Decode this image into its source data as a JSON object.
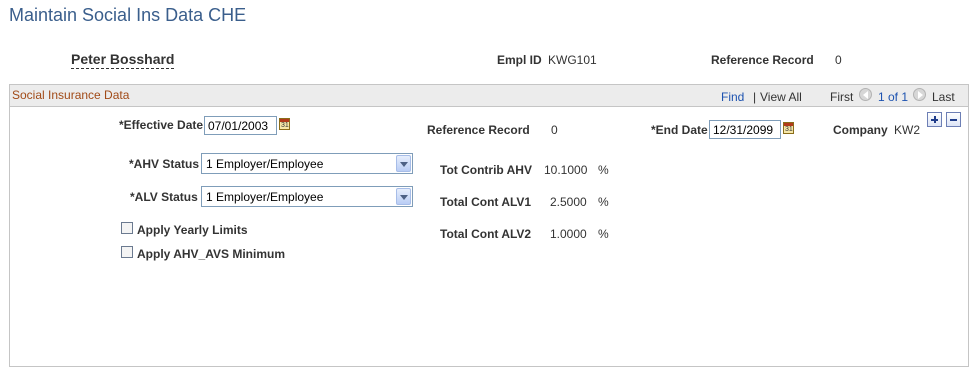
{
  "page": {
    "title": "Maintain Social Ins Data CHE"
  },
  "employee": {
    "name": "Peter Bosshard",
    "empl_id_label": "Empl ID",
    "empl_id": "KWG101",
    "ref_record_label": "Reference Record",
    "ref_record": "0"
  },
  "panel": {
    "title": "Social Insurance Data",
    "find": "Find",
    "separator": "|",
    "view_all": "View All",
    "first": "First",
    "page_info": "1 of 1",
    "last": "Last"
  },
  "form": {
    "effective_date_label": "*Effective Date",
    "effective_date": "07/01/2003",
    "reference_record_label": "Reference Record",
    "reference_record": "0",
    "end_date_label": "*End Date",
    "end_date": "12/31/2099",
    "company_label": "Company",
    "company": "KW2",
    "ahv_status_label": "*AHV Status",
    "ahv_status": "1 Employer/Employee",
    "alv_status_label": "*ALV Status",
    "alv_status": "1 Employer/Employee",
    "apply_yearly_limits_label": "Apply Yearly Limits",
    "apply_yearly_limits": false,
    "apply_ahv_min_label": "Apply AHV_AVS Minimum",
    "apply_ahv_min": false,
    "tot_contrib_ahv_label": "Tot Contrib AHV",
    "tot_contrib_ahv": "10.1000",
    "total_cont_alv1_label": "Total Cont ALV1",
    "total_cont_alv1": "2.5000",
    "total_cont_alv2_label": "Total Cont ALV2",
    "total_cont_alv2": "1.0000",
    "percent": "%",
    "calendar_icon_text": "31"
  },
  "colors": {
    "title": "#3a5e8c",
    "panel_title": "#a14a17",
    "link": "#1c52b0"
  },
  "icons": {
    "calendar": "calendar-icon",
    "previous": "previous-icon",
    "next": "next-icon",
    "add_row": "plus-icon",
    "delete_row": "minus-icon"
  }
}
